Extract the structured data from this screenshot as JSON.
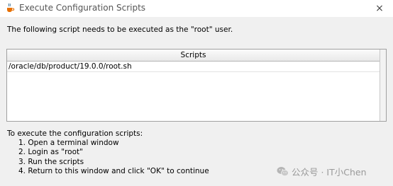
{
  "window": {
    "title": "Execute Configuration Scripts",
    "close_glyph": "×",
    "title_icon": "java-cup-icon",
    "close_icon": "close-icon"
  },
  "intro_text": "The following script needs to be executed as the \"root\" user.",
  "scripts_table": {
    "header": "Scripts",
    "rows": [
      "/oracle/db/product/19.0.0/root.sh"
    ]
  },
  "instructions": {
    "heading": "To execute the configuration scripts:",
    "steps": [
      "1. Open a terminal window",
      "2. Login as \"root\"",
      "3. Run the scripts",
      "4. Return to this window and click \"OK\" to continue"
    ]
  },
  "watermark": {
    "text": "公众号 · IT小Chen",
    "icon": "wechat-icon"
  }
}
